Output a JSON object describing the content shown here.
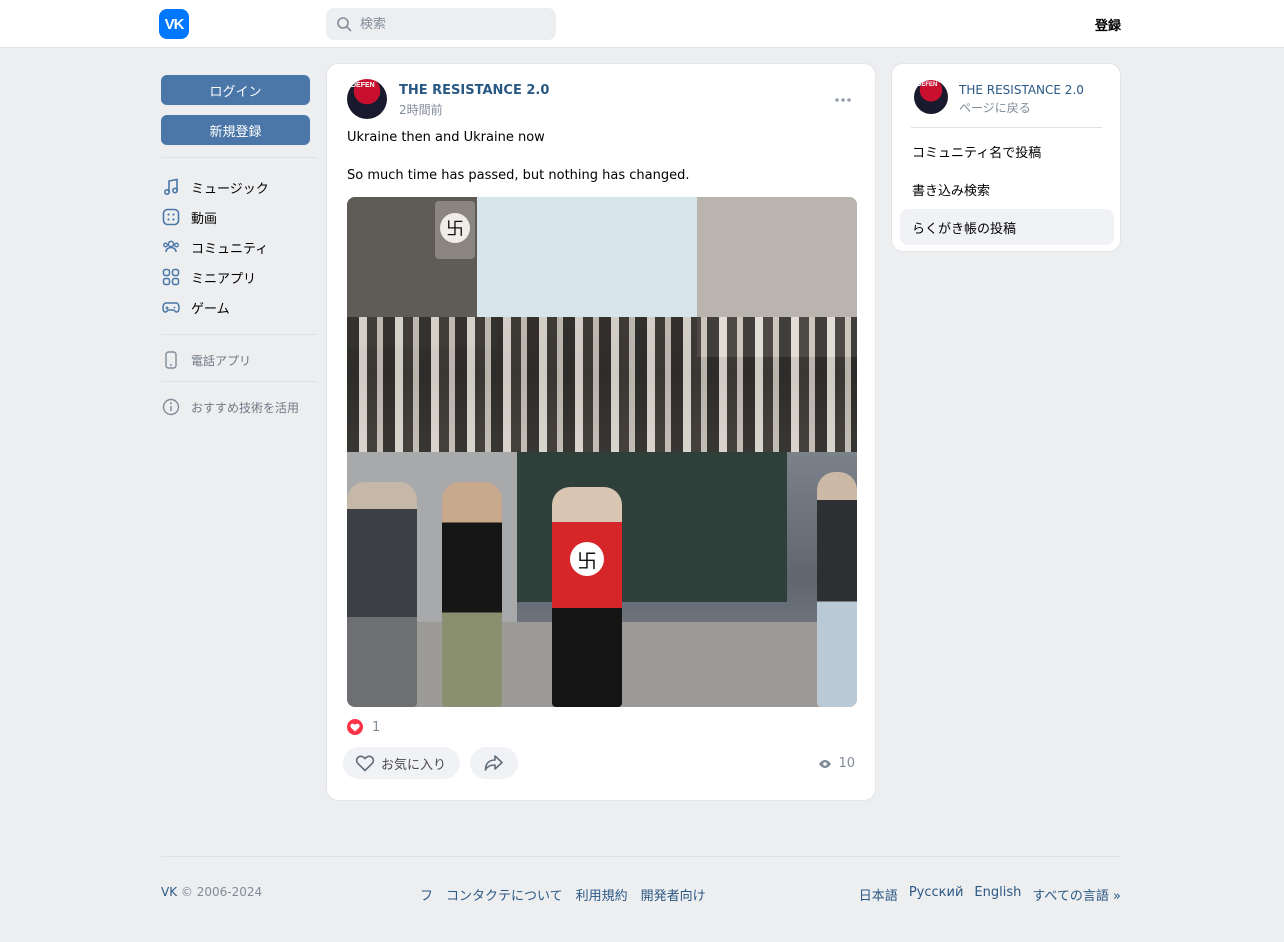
{
  "header": {
    "logo_text": "VK",
    "search_placeholder": "検索",
    "register_label": "登録"
  },
  "leftnav": {
    "login_label": "ログイン",
    "signup_label": "新規登録",
    "items": [
      {
        "label": "ミュージック",
        "icon": "music-icon"
      },
      {
        "label": "動画",
        "icon": "video-icon"
      },
      {
        "label": "コミュニティ",
        "icon": "community-icon"
      },
      {
        "label": "ミニアプリ",
        "icon": "mini-apps-icon"
      },
      {
        "label": "ゲーム",
        "icon": "gamepad-icon"
      }
    ],
    "phone_app_label": "電話アプリ",
    "recommend_label": "おすすめ技術を活用"
  },
  "post": {
    "author": "THE RESISTANCE 2.0",
    "avatar_text": "DEFEN",
    "time": "2時間前",
    "text_line1": "Ukraine then and Ukraine now",
    "text_line2": "So much time has passed, but nothing has changed.",
    "reactions_count": "1",
    "like_label": "お気に入り",
    "views_count": "10"
  },
  "rightcard": {
    "name": "THE RESISTANCE 2.0",
    "back_label": "ページに戻る",
    "items": [
      {
        "label": "コミュニティ名で投稿"
      },
      {
        "label": "書き込み検索"
      },
      {
        "label": "らくがき帳の投稿"
      }
    ]
  },
  "footer": {
    "brand": "VK",
    "copyright": "© 2006-2024",
    "links": [
      "フ",
      "コンタクテについて",
      "利用規約",
      "開発者向け"
    ],
    "langs": [
      "日本語",
      "Русский",
      "English",
      "すべての言語 »"
    ]
  },
  "colors": {
    "accent": "#0077ff",
    "button": "#4a76a8",
    "link": "#2a5885",
    "like": "#ff3347"
  }
}
